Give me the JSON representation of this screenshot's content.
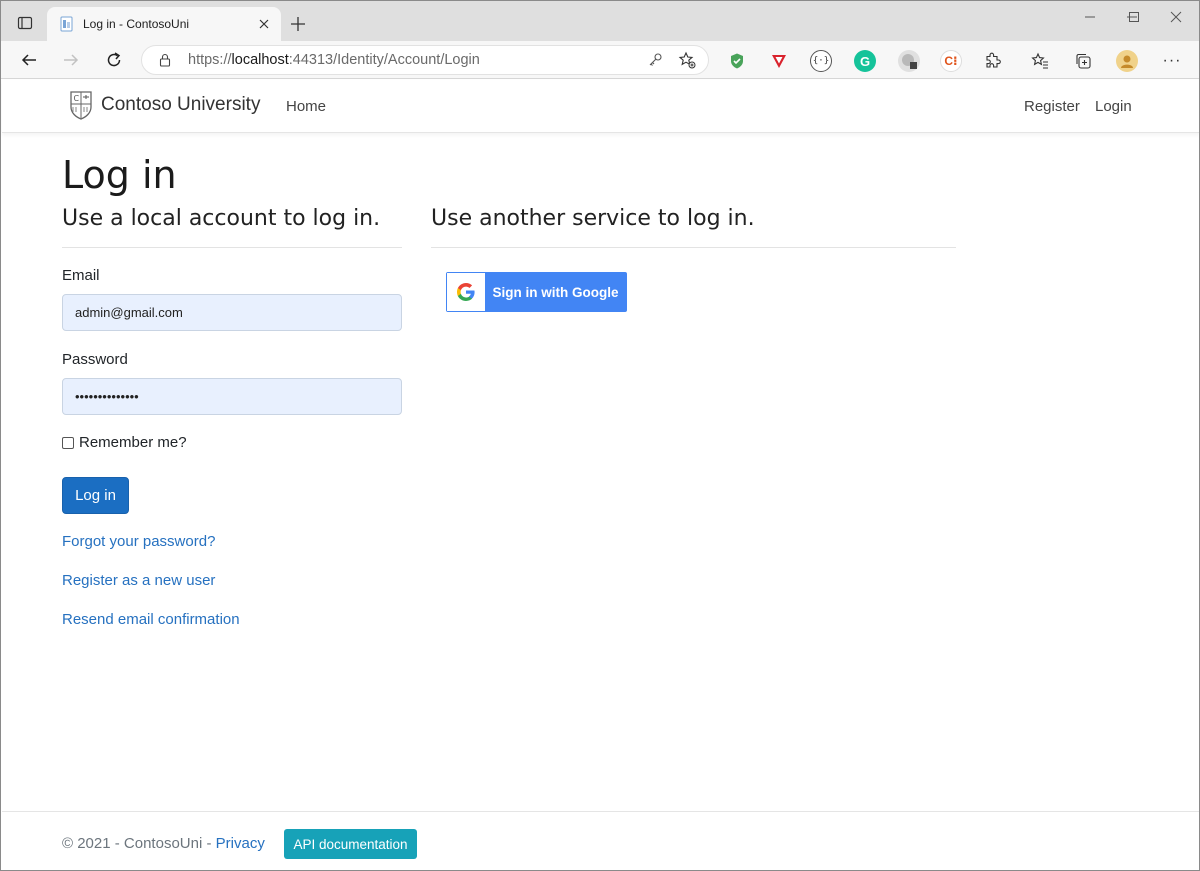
{
  "browser": {
    "tab_title": "Log in - ContosoUni",
    "url_prefix": "https://",
    "url_host": "localhost",
    "url_rest": ":44313/Identity/Account/Login",
    "new_tab_label": "+"
  },
  "site": {
    "brand": "Contoso University",
    "nav": {
      "home": "Home",
      "register": "Register",
      "login": "Login"
    }
  },
  "page": {
    "title": "Log in",
    "local_heading": "Use a local account to log in.",
    "external_heading": "Use another service to log in.",
    "email_label": "Email",
    "email_value": "admin@gmail.com",
    "password_label": "Password",
    "password_value": "••••••••••••••",
    "remember_label": "Remember me?",
    "remember_checked": false,
    "login_button": "Log in",
    "links": {
      "forgot": "Forgot your password?",
      "register": "Register as a new user",
      "resend": "Resend email confirmation"
    },
    "google_button": "Sign in with Google"
  },
  "footer": {
    "copyright": "© 2021 - ContosoUni - ",
    "privacy": "Privacy",
    "api_button": "API documentation"
  },
  "colors": {
    "primary": "#1b6ec2",
    "link": "#2671c0",
    "google_blue": "#4285f4",
    "info": "#17a2b8",
    "autofill_bg": "#e8f0fe"
  }
}
